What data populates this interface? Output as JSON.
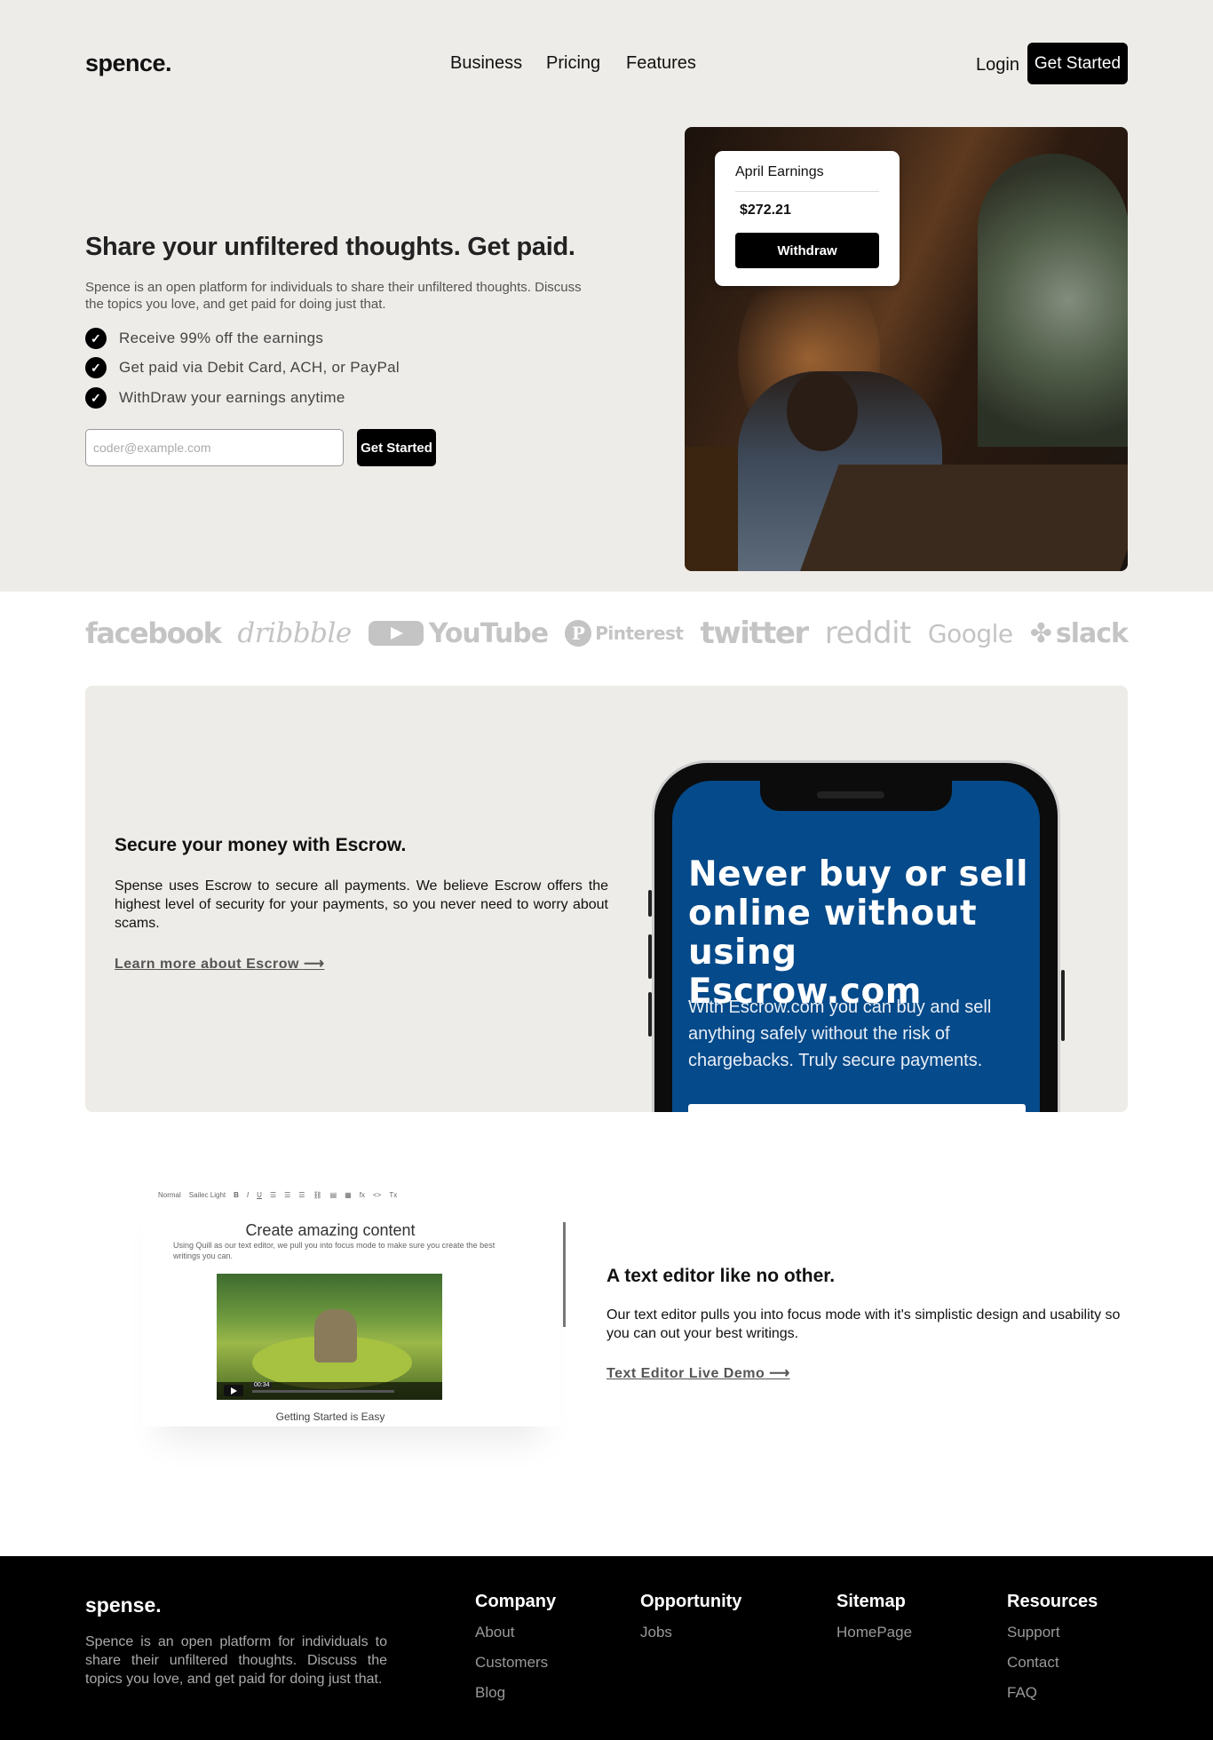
{
  "header": {
    "logo": "spence.",
    "nav": [
      "Business",
      "Pricing",
      "Features"
    ],
    "login": "Login",
    "cta": "Get Started"
  },
  "hero": {
    "title": "Share your unfiltered thoughts. Get paid.",
    "description": "Spence is an open platform for individuals to share their unfiltered thoughts. Discuss the topics you love, and get paid for doing just that.",
    "features": [
      "Receive 99% off the earnings",
      "Get paid via Debit Card, ACH, or PayPal",
      "WithDraw your earnings anytime"
    ],
    "email_placeholder": "coder@example.com",
    "cta": "Get Started",
    "card": {
      "label": "April Earnings",
      "amount": "$272.21",
      "button": "Withdraw"
    }
  },
  "brands": [
    "facebook",
    "dribbble",
    "YouTube",
    "Pinterest",
    "twitter",
    "reddit",
    "Google",
    "slack"
  ],
  "escrow": {
    "title": "Secure your money with Escrow.",
    "description": "Spense uses Escrow to secure all payments. We believe Escrow offers the highest level of security for your payments, so you never need to worry about scams.",
    "link": "Learn more about Escrow",
    "arrow": "⟶",
    "phone": {
      "headline": "Never buy or sell online without using Escrow.com",
      "text": "With Escrow.com you can buy and sell anything safely without the risk of chargebacks. Truly secure payments."
    }
  },
  "editor": {
    "toolbar": [
      "Normal",
      "Sailec Light",
      "B",
      "I",
      "U",
      "☰",
      "☰",
      "☰",
      "⛓",
      "▤",
      "▦",
      "fx",
      "<>",
      "Tx"
    ],
    "title": "Create amazing content",
    "subtitle": "Using Quill as our text editor, we pull you into focus mode to make sure you create the best writings you can.",
    "video_time": "00:34",
    "caption": "Getting Started is Easy",
    "section_title": "A text editor like no other.",
    "section_desc": "Our text editor pulls you into focus mode with it's simplistic design and usability so you can out your best writings.",
    "link": "Text Editor Live Demo",
    "arrow": "⟶"
  },
  "footer": {
    "logo": "spense.",
    "description": "Spence is an open platform for individuals to share their unfiltered thoughts. Discuss the topics you love, and get paid for doing just that.",
    "columns": [
      {
        "title": "Company",
        "links": [
          "About",
          "Customers",
          "Blog"
        ]
      },
      {
        "title": "Opportunity",
        "links": [
          "Jobs"
        ]
      },
      {
        "title": "Sitemap",
        "links": [
          "HomePage"
        ]
      },
      {
        "title": "Resources",
        "links": [
          "Support",
          "Contact",
          "FAQ"
        ]
      }
    ]
  },
  "colors": {
    "hero_bg": "#eeece8",
    "escrow_blue": "#054a8a",
    "brand_gray": "#c4c4c4",
    "footer_bg": "#000000"
  }
}
